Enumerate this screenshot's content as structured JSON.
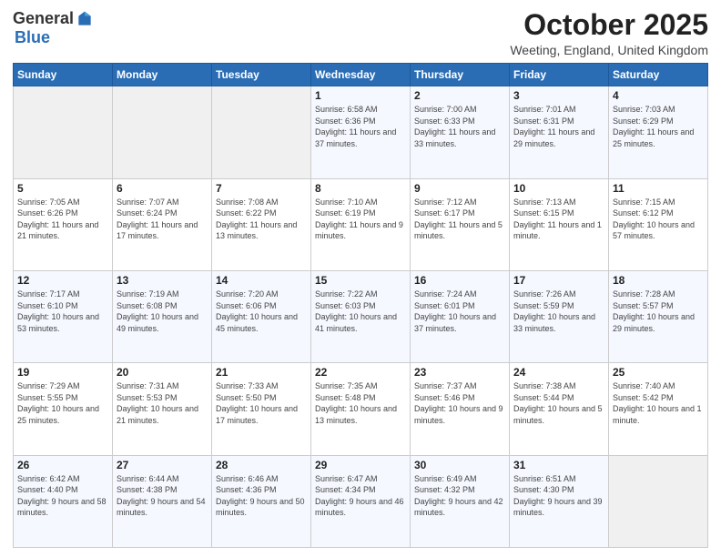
{
  "logo": {
    "general": "General",
    "blue": "Blue"
  },
  "header": {
    "month": "October 2025",
    "location": "Weeting, England, United Kingdom"
  },
  "days_of_week": [
    "Sunday",
    "Monday",
    "Tuesday",
    "Wednesday",
    "Thursday",
    "Friday",
    "Saturday"
  ],
  "weeks": [
    [
      {
        "day": "",
        "sunrise": "",
        "sunset": "",
        "daylight": ""
      },
      {
        "day": "",
        "sunrise": "",
        "sunset": "",
        "daylight": ""
      },
      {
        "day": "",
        "sunrise": "",
        "sunset": "",
        "daylight": ""
      },
      {
        "day": "1",
        "sunrise": "Sunrise: 6:58 AM",
        "sunset": "Sunset: 6:36 PM",
        "daylight": "Daylight: 11 hours and 37 minutes."
      },
      {
        "day": "2",
        "sunrise": "Sunrise: 7:00 AM",
        "sunset": "Sunset: 6:33 PM",
        "daylight": "Daylight: 11 hours and 33 minutes."
      },
      {
        "day": "3",
        "sunrise": "Sunrise: 7:01 AM",
        "sunset": "Sunset: 6:31 PM",
        "daylight": "Daylight: 11 hours and 29 minutes."
      },
      {
        "day": "4",
        "sunrise": "Sunrise: 7:03 AM",
        "sunset": "Sunset: 6:29 PM",
        "daylight": "Daylight: 11 hours and 25 minutes."
      }
    ],
    [
      {
        "day": "5",
        "sunrise": "Sunrise: 7:05 AM",
        "sunset": "Sunset: 6:26 PM",
        "daylight": "Daylight: 11 hours and 21 minutes."
      },
      {
        "day": "6",
        "sunrise": "Sunrise: 7:07 AM",
        "sunset": "Sunset: 6:24 PM",
        "daylight": "Daylight: 11 hours and 17 minutes."
      },
      {
        "day": "7",
        "sunrise": "Sunrise: 7:08 AM",
        "sunset": "Sunset: 6:22 PM",
        "daylight": "Daylight: 11 hours and 13 minutes."
      },
      {
        "day": "8",
        "sunrise": "Sunrise: 7:10 AM",
        "sunset": "Sunset: 6:19 PM",
        "daylight": "Daylight: 11 hours and 9 minutes."
      },
      {
        "day": "9",
        "sunrise": "Sunrise: 7:12 AM",
        "sunset": "Sunset: 6:17 PM",
        "daylight": "Daylight: 11 hours and 5 minutes."
      },
      {
        "day": "10",
        "sunrise": "Sunrise: 7:13 AM",
        "sunset": "Sunset: 6:15 PM",
        "daylight": "Daylight: 11 hours and 1 minute."
      },
      {
        "day": "11",
        "sunrise": "Sunrise: 7:15 AM",
        "sunset": "Sunset: 6:12 PM",
        "daylight": "Daylight: 10 hours and 57 minutes."
      }
    ],
    [
      {
        "day": "12",
        "sunrise": "Sunrise: 7:17 AM",
        "sunset": "Sunset: 6:10 PM",
        "daylight": "Daylight: 10 hours and 53 minutes."
      },
      {
        "day": "13",
        "sunrise": "Sunrise: 7:19 AM",
        "sunset": "Sunset: 6:08 PM",
        "daylight": "Daylight: 10 hours and 49 minutes."
      },
      {
        "day": "14",
        "sunrise": "Sunrise: 7:20 AM",
        "sunset": "Sunset: 6:06 PM",
        "daylight": "Daylight: 10 hours and 45 minutes."
      },
      {
        "day": "15",
        "sunrise": "Sunrise: 7:22 AM",
        "sunset": "Sunset: 6:03 PM",
        "daylight": "Daylight: 10 hours and 41 minutes."
      },
      {
        "day": "16",
        "sunrise": "Sunrise: 7:24 AM",
        "sunset": "Sunset: 6:01 PM",
        "daylight": "Daylight: 10 hours and 37 minutes."
      },
      {
        "day": "17",
        "sunrise": "Sunrise: 7:26 AM",
        "sunset": "Sunset: 5:59 PM",
        "daylight": "Daylight: 10 hours and 33 minutes."
      },
      {
        "day": "18",
        "sunrise": "Sunrise: 7:28 AM",
        "sunset": "Sunset: 5:57 PM",
        "daylight": "Daylight: 10 hours and 29 minutes."
      }
    ],
    [
      {
        "day": "19",
        "sunrise": "Sunrise: 7:29 AM",
        "sunset": "Sunset: 5:55 PM",
        "daylight": "Daylight: 10 hours and 25 minutes."
      },
      {
        "day": "20",
        "sunrise": "Sunrise: 7:31 AM",
        "sunset": "Sunset: 5:53 PM",
        "daylight": "Daylight: 10 hours and 21 minutes."
      },
      {
        "day": "21",
        "sunrise": "Sunrise: 7:33 AM",
        "sunset": "Sunset: 5:50 PM",
        "daylight": "Daylight: 10 hours and 17 minutes."
      },
      {
        "day": "22",
        "sunrise": "Sunrise: 7:35 AM",
        "sunset": "Sunset: 5:48 PM",
        "daylight": "Daylight: 10 hours and 13 minutes."
      },
      {
        "day": "23",
        "sunrise": "Sunrise: 7:37 AM",
        "sunset": "Sunset: 5:46 PM",
        "daylight": "Daylight: 10 hours and 9 minutes."
      },
      {
        "day": "24",
        "sunrise": "Sunrise: 7:38 AM",
        "sunset": "Sunset: 5:44 PM",
        "daylight": "Daylight: 10 hours and 5 minutes."
      },
      {
        "day": "25",
        "sunrise": "Sunrise: 7:40 AM",
        "sunset": "Sunset: 5:42 PM",
        "daylight": "Daylight: 10 hours and 1 minute."
      }
    ],
    [
      {
        "day": "26",
        "sunrise": "Sunrise: 6:42 AM",
        "sunset": "Sunset: 4:40 PM",
        "daylight": "Daylight: 9 hours and 58 minutes."
      },
      {
        "day": "27",
        "sunrise": "Sunrise: 6:44 AM",
        "sunset": "Sunset: 4:38 PM",
        "daylight": "Daylight: 9 hours and 54 minutes."
      },
      {
        "day": "28",
        "sunrise": "Sunrise: 6:46 AM",
        "sunset": "Sunset: 4:36 PM",
        "daylight": "Daylight: 9 hours and 50 minutes."
      },
      {
        "day": "29",
        "sunrise": "Sunrise: 6:47 AM",
        "sunset": "Sunset: 4:34 PM",
        "daylight": "Daylight: 9 hours and 46 minutes."
      },
      {
        "day": "30",
        "sunrise": "Sunrise: 6:49 AM",
        "sunset": "Sunset: 4:32 PM",
        "daylight": "Daylight: 9 hours and 42 minutes."
      },
      {
        "day": "31",
        "sunrise": "Sunrise: 6:51 AM",
        "sunset": "Sunset: 4:30 PM",
        "daylight": "Daylight: 9 hours and 39 minutes."
      },
      {
        "day": "",
        "sunrise": "",
        "sunset": "",
        "daylight": ""
      }
    ]
  ]
}
